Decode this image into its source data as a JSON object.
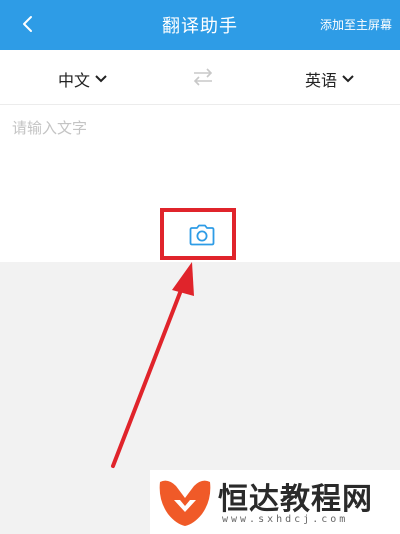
{
  "header": {
    "title": "翻译助手",
    "add_to_home": "添加至主屏幕",
    "back_icon": "chevron-left-icon"
  },
  "languages": {
    "source": "中文",
    "target": "英语",
    "swap_icon": "swap-arrows-icon"
  },
  "input": {
    "placeholder": "请输入文字"
  },
  "camera": {
    "icon": "camera-icon"
  },
  "watermark": {
    "name": "恒达教程网",
    "url": "www.sxhdcj.com"
  },
  "colors": {
    "header_bg": "#2e9ce6",
    "camera": "#2e9ce6",
    "highlight": "#e0242b",
    "logo": "#f05a28"
  }
}
